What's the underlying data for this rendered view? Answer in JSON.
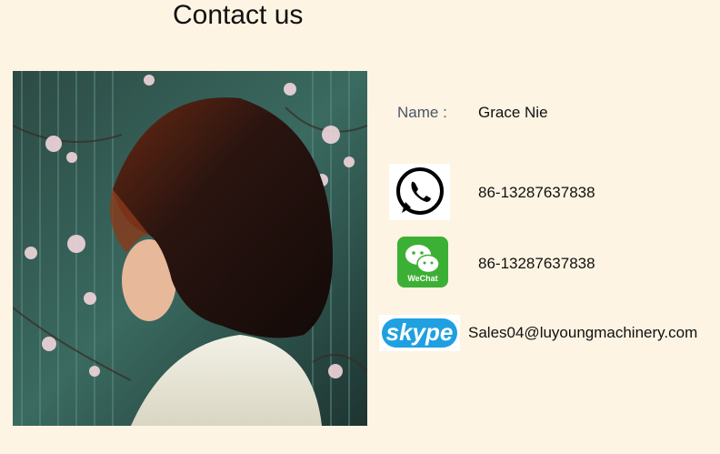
{
  "header": {
    "title": "Contact us"
  },
  "contact": {
    "name_label": "Name :",
    "name_value": "Grace Nie",
    "whatsapp": {
      "icon": "whatsapp-icon",
      "value": "86-13287637838"
    },
    "wechat": {
      "icon": "wechat-icon",
      "label": "WeChat",
      "value": "86-13287637838"
    },
    "skype": {
      "icon": "skype-icon",
      "label": "skype",
      "value": "Sales04@luyoungmachinery.com"
    }
  },
  "colors": {
    "background": "#fdf4e3",
    "wechat_green": "#3cb034",
    "skype_blue": "#1fa0e0"
  }
}
